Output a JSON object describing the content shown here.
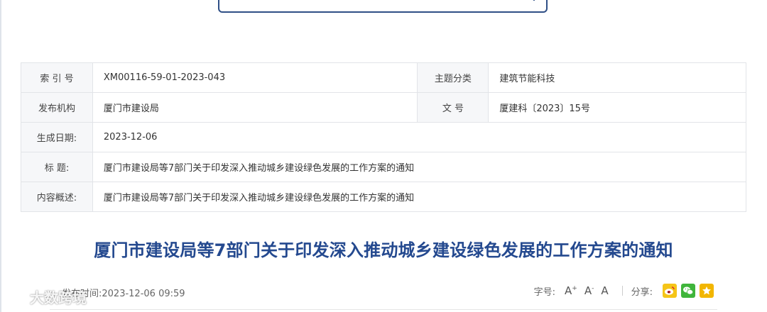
{
  "meta": {
    "index_label": "索 引 号",
    "index_value": "XM00116-59-01-2023-043",
    "topic_label": "主题分类",
    "topic_value": "建筑节能科技",
    "issuer_label": "发布机构",
    "issuer_value": "厦门市建设局",
    "docno_label": "文 号",
    "docno_value": "厦建科〔2023〕15号",
    "date_label": "生成日期:",
    "date_value": "2023-12-06",
    "title_label": "标 题:",
    "title_value": "厦门市建设局等7部门关于印发深入推动城乡建设绿色发展的工作方案的通知",
    "summary_label": "内容概述:",
    "summary_value": "厦门市建设局等7部门关于印发深入推动城乡建设绿色发展的工作方案的通知"
  },
  "article": {
    "title": "厦门市建设局等7部门关于印发深入推动城乡建设绿色发展的工作方案的通知",
    "publish_label": "发布时间:",
    "publish_time": "2023-12-06 09:59"
  },
  "toolbar": {
    "font_label": "字号:",
    "font_large": "A",
    "font_large_sup": "+",
    "font_small": "A",
    "font_small_sup": "-",
    "font_default": "A",
    "share_label": "分享:"
  },
  "share_icons": [
    "weibo-icon",
    "wechat-icon",
    "favorite-icon"
  ],
  "colors": {
    "accent": "#24498f",
    "search_border": "#2f4f86",
    "label_bg": "#f6f7f9",
    "weibo": "#f5c518",
    "wechat": "#3fb53b",
    "favorite": "#f2b600"
  },
  "watermark": {
    "text": "大数跨境"
  }
}
